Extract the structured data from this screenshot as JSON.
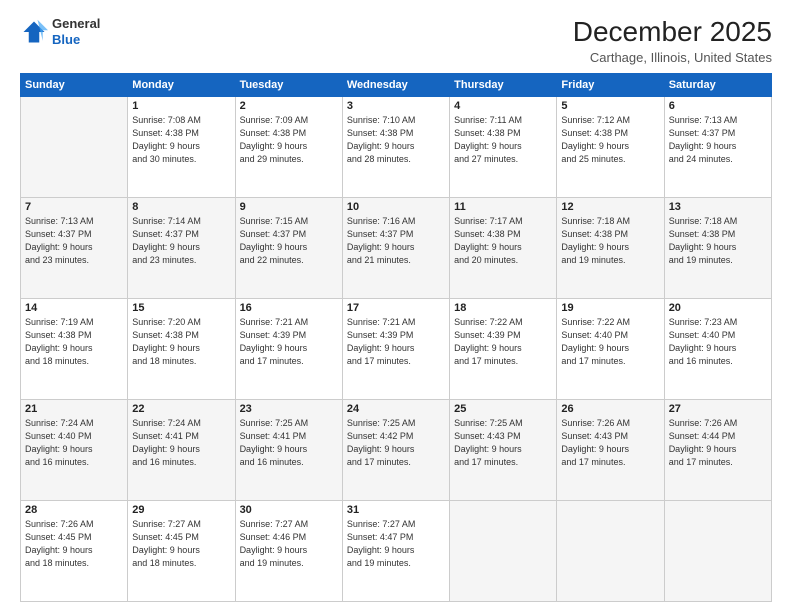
{
  "logo": {
    "general": "General",
    "blue": "Blue"
  },
  "header": {
    "month": "December 2025",
    "location": "Carthage, Illinois, United States"
  },
  "weekdays": [
    "Sunday",
    "Monday",
    "Tuesday",
    "Wednesday",
    "Thursday",
    "Friday",
    "Saturday"
  ],
  "weeks": [
    [
      {
        "num": "",
        "info": ""
      },
      {
        "num": "1",
        "info": "Sunrise: 7:08 AM\nSunset: 4:38 PM\nDaylight: 9 hours\nand 30 minutes."
      },
      {
        "num": "2",
        "info": "Sunrise: 7:09 AM\nSunset: 4:38 PM\nDaylight: 9 hours\nand 29 minutes."
      },
      {
        "num": "3",
        "info": "Sunrise: 7:10 AM\nSunset: 4:38 PM\nDaylight: 9 hours\nand 28 minutes."
      },
      {
        "num": "4",
        "info": "Sunrise: 7:11 AM\nSunset: 4:38 PM\nDaylight: 9 hours\nand 27 minutes."
      },
      {
        "num": "5",
        "info": "Sunrise: 7:12 AM\nSunset: 4:38 PM\nDaylight: 9 hours\nand 25 minutes."
      },
      {
        "num": "6",
        "info": "Sunrise: 7:13 AM\nSunset: 4:37 PM\nDaylight: 9 hours\nand 24 minutes."
      }
    ],
    [
      {
        "num": "7",
        "info": "Sunrise: 7:13 AM\nSunset: 4:37 PM\nDaylight: 9 hours\nand 23 minutes."
      },
      {
        "num": "8",
        "info": "Sunrise: 7:14 AM\nSunset: 4:37 PM\nDaylight: 9 hours\nand 23 minutes."
      },
      {
        "num": "9",
        "info": "Sunrise: 7:15 AM\nSunset: 4:37 PM\nDaylight: 9 hours\nand 22 minutes."
      },
      {
        "num": "10",
        "info": "Sunrise: 7:16 AM\nSunset: 4:37 PM\nDaylight: 9 hours\nand 21 minutes."
      },
      {
        "num": "11",
        "info": "Sunrise: 7:17 AM\nSunset: 4:38 PM\nDaylight: 9 hours\nand 20 minutes."
      },
      {
        "num": "12",
        "info": "Sunrise: 7:18 AM\nSunset: 4:38 PM\nDaylight: 9 hours\nand 19 minutes."
      },
      {
        "num": "13",
        "info": "Sunrise: 7:18 AM\nSunset: 4:38 PM\nDaylight: 9 hours\nand 19 minutes."
      }
    ],
    [
      {
        "num": "14",
        "info": "Sunrise: 7:19 AM\nSunset: 4:38 PM\nDaylight: 9 hours\nand 18 minutes."
      },
      {
        "num": "15",
        "info": "Sunrise: 7:20 AM\nSunset: 4:38 PM\nDaylight: 9 hours\nand 18 minutes."
      },
      {
        "num": "16",
        "info": "Sunrise: 7:21 AM\nSunset: 4:39 PM\nDaylight: 9 hours\nand 17 minutes."
      },
      {
        "num": "17",
        "info": "Sunrise: 7:21 AM\nSunset: 4:39 PM\nDaylight: 9 hours\nand 17 minutes."
      },
      {
        "num": "18",
        "info": "Sunrise: 7:22 AM\nSunset: 4:39 PM\nDaylight: 9 hours\nand 17 minutes."
      },
      {
        "num": "19",
        "info": "Sunrise: 7:22 AM\nSunset: 4:40 PM\nDaylight: 9 hours\nand 17 minutes."
      },
      {
        "num": "20",
        "info": "Sunrise: 7:23 AM\nSunset: 4:40 PM\nDaylight: 9 hours\nand 16 minutes."
      }
    ],
    [
      {
        "num": "21",
        "info": "Sunrise: 7:24 AM\nSunset: 4:40 PM\nDaylight: 9 hours\nand 16 minutes."
      },
      {
        "num": "22",
        "info": "Sunrise: 7:24 AM\nSunset: 4:41 PM\nDaylight: 9 hours\nand 16 minutes."
      },
      {
        "num": "23",
        "info": "Sunrise: 7:25 AM\nSunset: 4:41 PM\nDaylight: 9 hours\nand 16 minutes."
      },
      {
        "num": "24",
        "info": "Sunrise: 7:25 AM\nSunset: 4:42 PM\nDaylight: 9 hours\nand 17 minutes."
      },
      {
        "num": "25",
        "info": "Sunrise: 7:25 AM\nSunset: 4:43 PM\nDaylight: 9 hours\nand 17 minutes."
      },
      {
        "num": "26",
        "info": "Sunrise: 7:26 AM\nSunset: 4:43 PM\nDaylight: 9 hours\nand 17 minutes."
      },
      {
        "num": "27",
        "info": "Sunrise: 7:26 AM\nSunset: 4:44 PM\nDaylight: 9 hours\nand 17 minutes."
      }
    ],
    [
      {
        "num": "28",
        "info": "Sunrise: 7:26 AM\nSunset: 4:45 PM\nDaylight: 9 hours\nand 18 minutes."
      },
      {
        "num": "29",
        "info": "Sunrise: 7:27 AM\nSunset: 4:45 PM\nDaylight: 9 hours\nand 18 minutes."
      },
      {
        "num": "30",
        "info": "Sunrise: 7:27 AM\nSunset: 4:46 PM\nDaylight: 9 hours\nand 19 minutes."
      },
      {
        "num": "31",
        "info": "Sunrise: 7:27 AM\nSunset: 4:47 PM\nDaylight: 9 hours\nand 19 minutes."
      },
      {
        "num": "",
        "info": ""
      },
      {
        "num": "",
        "info": ""
      },
      {
        "num": "",
        "info": ""
      }
    ]
  ]
}
